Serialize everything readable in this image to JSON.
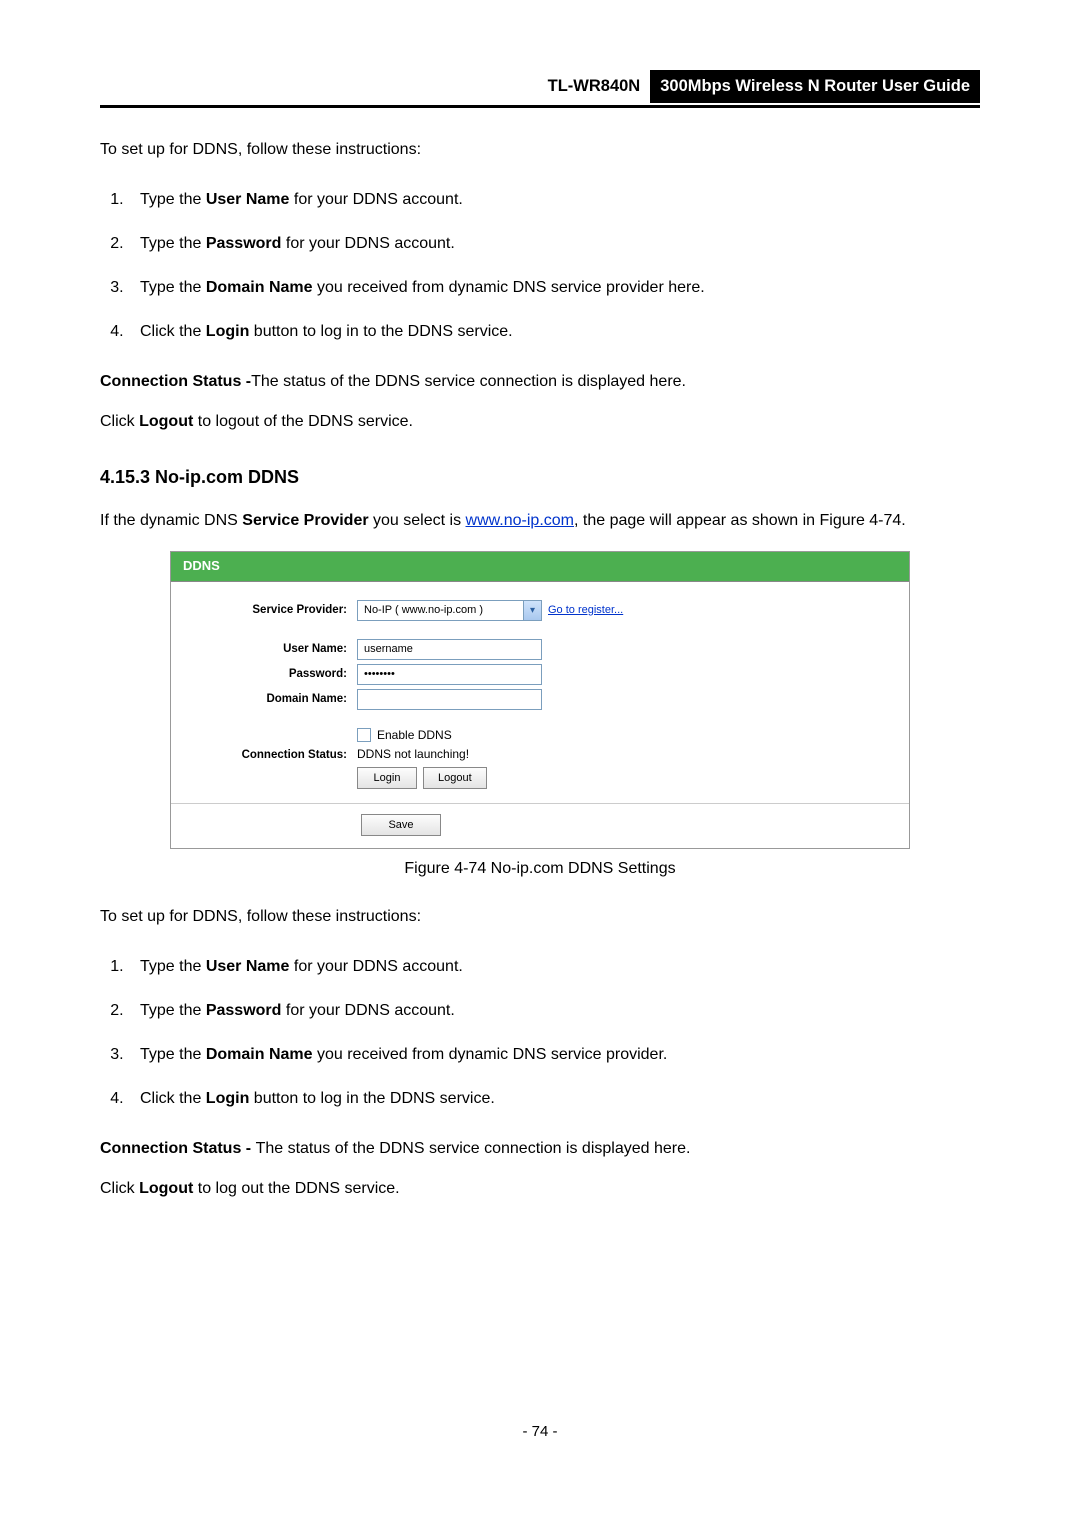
{
  "header": {
    "model": "TL-WR840N",
    "guide": "300Mbps Wireless N Router User Guide"
  },
  "intro1": "To set up for DDNS, follow these instructions:",
  "steps1": [
    {
      "prefix": "Type the ",
      "bold": "User Name",
      "suffix": " for your DDNS account."
    },
    {
      "prefix": "Type the ",
      "bold": "Password",
      "suffix": " for your DDNS account."
    },
    {
      "prefix": "Type the ",
      "bold": "Domain Name",
      "suffix": " you received from dynamic DNS service provider here."
    },
    {
      "prefix": "Click the ",
      "bold": "Login",
      "suffix": " button to log in to the DDNS service."
    }
  ],
  "conn_status1": {
    "label": "Connection Status -",
    "text": "The status of the DDNS service connection is displayed here."
  },
  "logout1": {
    "prefix": "Click ",
    "bold": "Logout",
    "suffix": " to logout of the DDNS service."
  },
  "section_heading": "4.15.3 No-ip.com DDNS",
  "section_intro": {
    "p1": "If the dynamic DNS ",
    "b1": "Service Provider",
    "p2": " you select is ",
    "link": "www.no-ip.com",
    "p3": ", the page will appear as shown in Figure 4-74."
  },
  "ddns": {
    "title": "DDNS",
    "labels": {
      "service_provider": "Service Provider:",
      "user_name": "User Name:",
      "password": "Password:",
      "domain_name": "Domain Name:",
      "connection_status": "Connection Status:"
    },
    "values": {
      "provider_selected": "No-IP ( www.no-ip.com )",
      "go_register": "Go to register...",
      "username": "username",
      "password_masked": "••••••••",
      "domain_name": "",
      "enable_ddns_label": "Enable DDNS",
      "status_text": "DDNS not launching!",
      "login_btn": "Login",
      "logout_btn": "Logout",
      "save_btn": "Save"
    }
  },
  "figure_caption": "Figure 4-74 No-ip.com DDNS Settings",
  "intro2": "To set up for DDNS, follow these instructions:",
  "steps2": [
    {
      "prefix": "Type the ",
      "bold": "User Name",
      "suffix": " for your DDNS account."
    },
    {
      "prefix": "Type the ",
      "bold": "Password",
      "suffix": " for your DDNS account."
    },
    {
      "prefix": "Type the ",
      "bold": "Domain Name",
      "suffix": " you received from dynamic DNS service provider."
    },
    {
      "prefix": "Click the ",
      "bold": "Login",
      "suffix": " button to log in the DDNS service."
    }
  ],
  "conn_status2": {
    "label": "Connection Status - ",
    "text": "The status of the DDNS service connection is displayed here."
  },
  "logout2": {
    "prefix": "Click ",
    "bold": "Logout",
    "suffix": " to log out the DDNS service."
  },
  "page_number": "- 74 -"
}
